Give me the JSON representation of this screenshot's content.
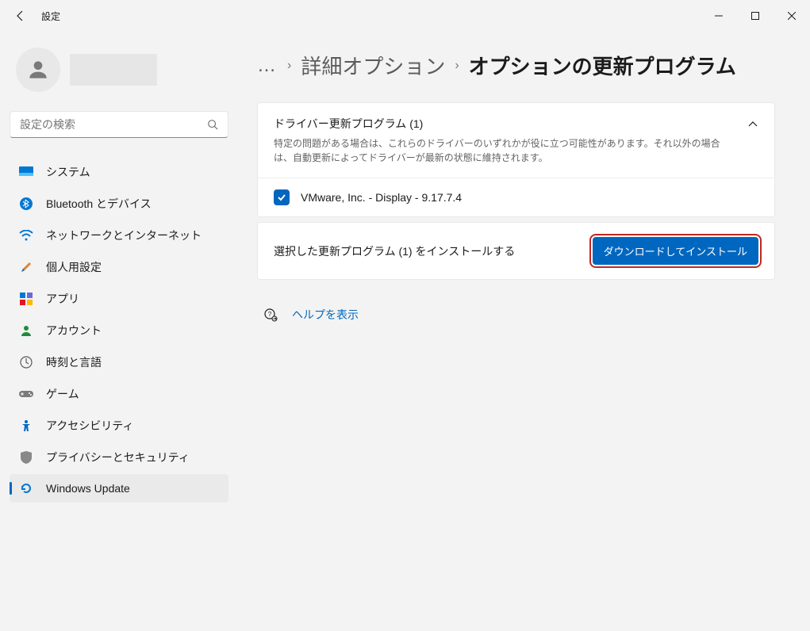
{
  "window": {
    "title": "設定"
  },
  "search": {
    "placeholder": "設定の検索"
  },
  "sidebar": {
    "items": [
      {
        "label": "システム"
      },
      {
        "label": "Bluetooth とデバイス"
      },
      {
        "label": "ネットワークとインターネット"
      },
      {
        "label": "個人用設定"
      },
      {
        "label": "アプリ"
      },
      {
        "label": "アカウント"
      },
      {
        "label": "時刻と言語"
      },
      {
        "label": "ゲーム"
      },
      {
        "label": "アクセシビリティ"
      },
      {
        "label": "プライバシーとセキュリティ"
      },
      {
        "label": "Windows Update"
      }
    ]
  },
  "breadcrumb": {
    "link": "詳細オプション",
    "current": "オプションの更新プログラム"
  },
  "driver_card": {
    "title": "ドライバー更新プログラム (1)",
    "desc": "特定の問題がある場合は、これらのドライバーのいずれかが役に立つ可能性があります。それ以外の場合は、自動更新によってドライバーが最新の状態に維持されます。",
    "items": [
      {
        "label": "VMware, Inc. - Display - 9.17.7.4",
        "checked": true
      }
    ]
  },
  "install": {
    "text": "選択した更新プログラム (1) をインストールする",
    "button": "ダウンロードしてインストール"
  },
  "help": {
    "label": "ヘルプを表示"
  },
  "colors": {
    "accent": "#0067c0"
  }
}
